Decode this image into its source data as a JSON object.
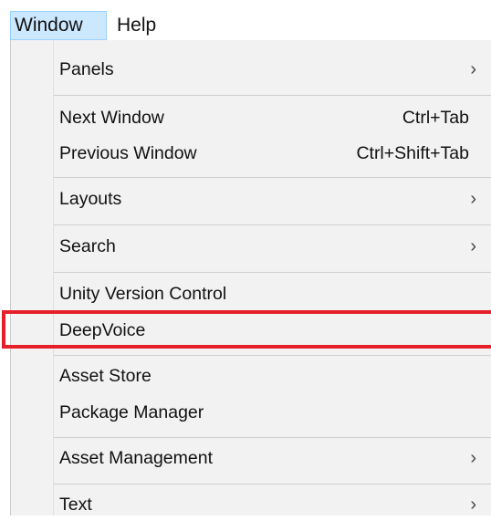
{
  "menubar": {
    "items": [
      {
        "label": "Window"
      },
      {
        "label": "Help"
      }
    ]
  },
  "menu": {
    "items": [
      {
        "label": "Panels",
        "submenu_arrow": "›"
      },
      {
        "label": "Next Window",
        "shortcut": "Ctrl+Tab"
      },
      {
        "label": "Previous Window",
        "shortcut": "Ctrl+Shift+Tab"
      },
      {
        "label": "Layouts",
        "submenu_arrow": "›"
      },
      {
        "label": "Search",
        "submenu_arrow": "›"
      },
      {
        "label": "Unity Version Control"
      },
      {
        "label": "DeepVoice"
      },
      {
        "label": "Asset Store"
      },
      {
        "label": "Package Manager"
      },
      {
        "label": "Asset Management",
        "submenu_arrow": "›"
      },
      {
        "label": "Text",
        "submenu_arrow": "›"
      }
    ]
  },
  "colors": {
    "active_menu_background": "#cce8ff",
    "menu_background": "#f2f2f2",
    "highlight_outline": "#e5202a"
  },
  "icons": {
    "submenu": "chevron-right-icon"
  }
}
